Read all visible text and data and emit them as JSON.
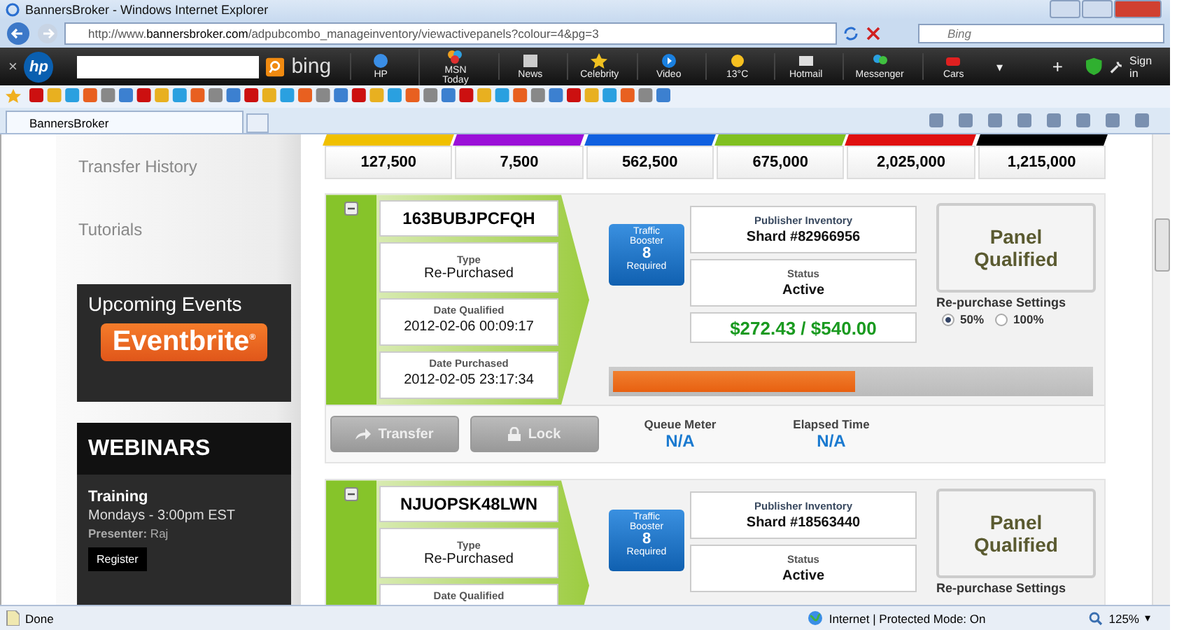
{
  "window": {
    "title": "BannersBroker - Windows Internet Explorer"
  },
  "address_bar": {
    "url": "http://www.**bannersbroker.com**/adpubcombo_manageinventory/viewactivepanels?colour=4&pg=3"
  },
  "search_box": {
    "placeholder": "Bing"
  },
  "toolbar": {
    "close": "×",
    "logo": "hp",
    "search_logo": "bing",
    "more": "▾",
    "add": "+",
    "sign_in": "Sign in",
    "items": [
      {
        "label": "HP"
      },
      {
        "label": "MSN Today"
      },
      {
        "label": "News"
      },
      {
        "label": "Celebrity"
      },
      {
        "label": "Video"
      },
      {
        "label": "13°C"
      },
      {
        "label": "Hotmail"
      },
      {
        "label": "Messenger"
      },
      {
        "label": "Cars"
      }
    ]
  },
  "tabs": [
    {
      "label": "BannersBroker",
      "selected": true
    }
  ],
  "sidebar": {
    "links": [
      "Transfer History",
      "Tutorials"
    ],
    "events": {
      "title": "Upcoming Events",
      "logo": "Eventbrite$^{®}$"
    },
    "webinars": {
      "title": "WEBINARS",
      "name": "Training",
      "schedule": "Mondays - 3:00pm EST",
      "presenter": "**Presenter:** Raj",
      "button": "Register"
    }
  },
  "levels": [
    {
      "value": "127,500",
      "color": "#f0c000"
    },
    {
      "value": "7,500",
      "color": "#9b10d8"
    },
    {
      "value": "562,500",
      "color": "#1060e0"
    },
    {
      "value": "675,000",
      "color": "#80c020"
    },
    {
      "value": "2,025,000",
      "color": "#e01010"
    },
    {
      "value": "1,215,000",
      "color": "#000000"
    }
  ],
  "panels": [
    {
      "id": "163BUBJPCFQH",
      "type_label": "Type",
      "type": "Re-Purchased",
      "dates": [
        {
          "label": "Date Qualified",
          "value": "2012-02-06 00:09:17"
        },
        {
          "label": "Date Purchased",
          "value": "2012-02-05 23:17:34"
        }
      ],
      "booster": {
        "title": "Traffic Booster",
        "count": "8",
        "note": "Required"
      },
      "publisher": {
        "label": "Publisher Inventory",
        "value": "Shard #82966956"
      },
      "status": {
        "label": "Status",
        "value": "Active"
      },
      "amount": "$272.43 / $540.00",
      "qualified": "Panel Qualified",
      "repurchase": {
        "label": "Re-purchase Settings",
        "options": [
          {
            "label": "50%",
            "selected": true
          },
          {
            "label": "100%",
            "selected": false
          }
        ]
      },
      "level": 0.51,
      "buttons": [
        {
          "label": "Transfer",
          "kind": "transfer"
        },
        {
          "label": "Lock",
          "kind": "lock"
        }
      ],
      "meters": [
        {
          "label": "Queue Meter",
          "value": "N/A"
        },
        {
          "label": "Elapsed Time",
          "value": "N/A"
        }
      ]
    },
    {
      "id": "NJUOPSK48LWN",
      "type_label": "Type",
      "type": "Re-Purchased",
      "dates": [
        {
          "label": "Date Qualified"
        }
      ],
      "booster": {
        "title": "Traffic Booster",
        "count": "8",
        "note": "Required"
      },
      "publisher": {
        "label": "Publisher Inventory",
        "value": "Shard #18563440"
      },
      "status": {
        "label": "Status",
        "value": "Active"
      },
      "qualified": "Panel Qualified",
      "repurchase": {
        "label": "Re-purchase Settings"
      }
    }
  ],
  "status_bar": {
    "text": "Done",
    "zone": "Internet | Protected Mode: On",
    "zoom": "125%",
    "zoom_menu": "▾"
  }
}
